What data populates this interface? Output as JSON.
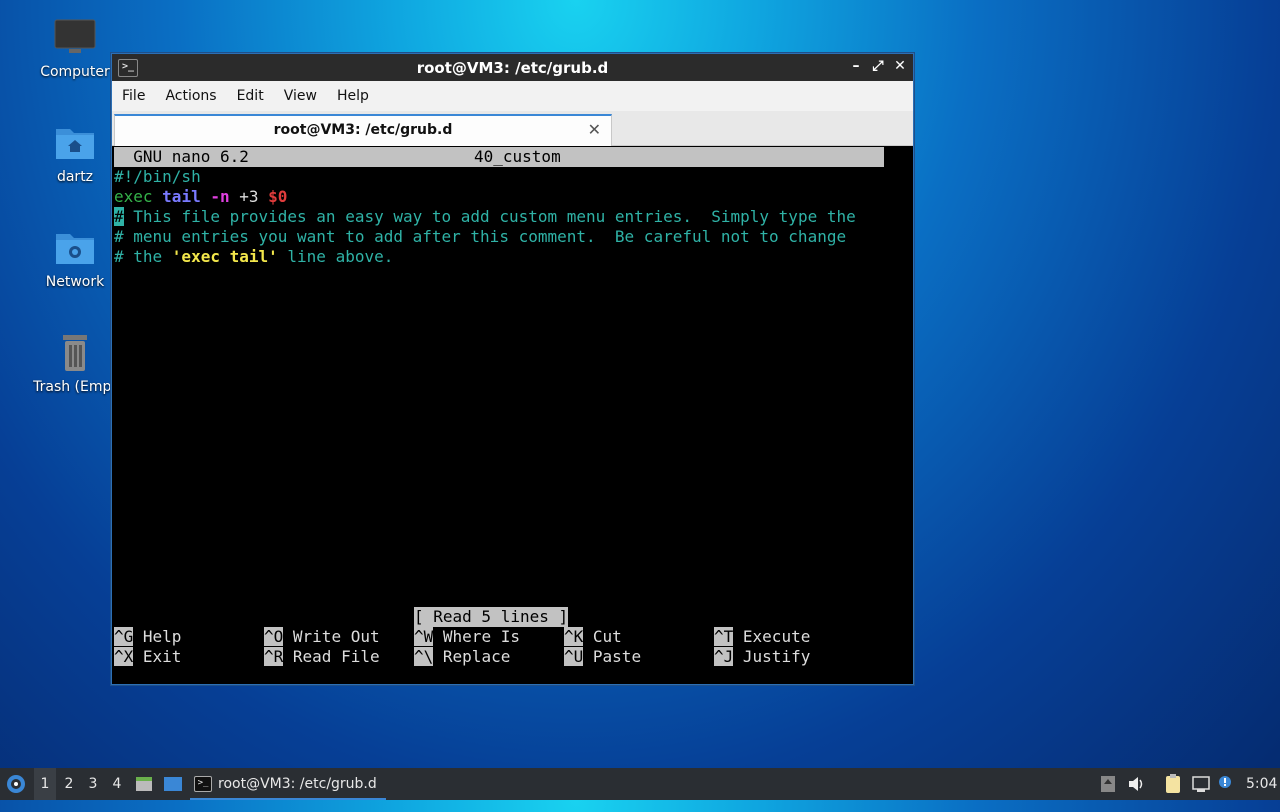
{
  "desktop": {
    "icons": [
      {
        "label": "Computer",
        "icon": "computer-icon"
      },
      {
        "label": "dartz",
        "icon": "home-folder-icon"
      },
      {
        "label": "Network",
        "icon": "network-folder-icon"
      },
      {
        "label": "Trash (Empt",
        "icon": "trash-icon"
      }
    ]
  },
  "window": {
    "title": "root@VM3: /etc/grub.d",
    "controls": {
      "minimize": "–",
      "maximize": "⤢",
      "close": "✕"
    },
    "menu": [
      "File",
      "Actions",
      "Edit",
      "View",
      "Help"
    ],
    "tab": {
      "title": "root@VM3: /etc/grub.d",
      "close": "✕"
    }
  },
  "nano": {
    "header_left": "  GNU nano 6.2",
    "header_file": "40_custom",
    "lines": {
      "l1": "#!/bin/sh",
      "l2_exec": "exec ",
      "l2_tail": "tail",
      "l2_sp": " ",
      "l2_n": "-n",
      "l2_mid": " +3 ",
      "l2_var": "$0",
      "l3_cursor": "#",
      "l3_rest": " This file provides an easy way to add custom menu entries.  Simply type the",
      "l4": "# menu entries you want to add after this comment.  Be careful not to change",
      "l5_a": "# the ",
      "l5_b": "'exec tail'",
      "l5_c": " line above."
    },
    "status": "[ Read 5 lines ]",
    "shortcuts": [
      {
        "key": "^G",
        "label": "Help"
      },
      {
        "key": "^O",
        "label": "Write Out"
      },
      {
        "key": "^W",
        "label": "Where Is"
      },
      {
        "key": "^K",
        "label": "Cut"
      },
      {
        "key": "^T",
        "label": "Execute"
      },
      {
        "key": "^X",
        "label": "Exit"
      },
      {
        "key": "^R",
        "label": "Read File"
      },
      {
        "key": "^\\",
        "label": "Replace"
      },
      {
        "key": "^U",
        "label": "Paste"
      },
      {
        "key": "^J",
        "label": "Justify"
      }
    ]
  },
  "taskbar": {
    "workspaces": [
      "1",
      "2",
      "3",
      "4"
    ],
    "active_task": "root@VM3: /etc/grub.d",
    "clock": "5:04"
  }
}
